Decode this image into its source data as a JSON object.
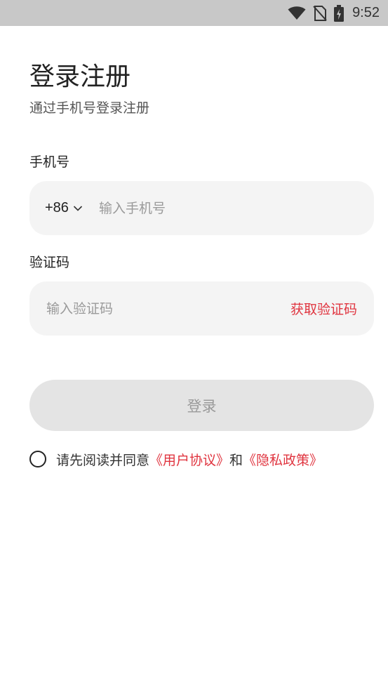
{
  "status_bar": {
    "time": "9:52",
    "icons": [
      "wifi-icon",
      "no-sim-icon",
      "battery-charging-icon"
    ]
  },
  "header": {
    "title": "登录注册",
    "subtitle": "通过手机号登录注册"
  },
  "phone": {
    "label": "手机号",
    "country_code": "+86",
    "placeholder": "输入手机号",
    "value": ""
  },
  "code": {
    "label": "验证码",
    "placeholder": "输入验证码",
    "value": "",
    "get_code_label": "获取验证码"
  },
  "login": {
    "label": "登录",
    "enabled": false
  },
  "agreement": {
    "checked": false,
    "prefix": "请先阅读并同意",
    "user_agreement": "《用户协议》",
    "connector": "和",
    "privacy_policy": "《隐私政策》"
  },
  "colors": {
    "accent": "#e0343f",
    "field_bg": "#f4f4f4",
    "disabled_button_bg": "#e4e4e4",
    "status_bar_bg": "#c8c8c8"
  }
}
